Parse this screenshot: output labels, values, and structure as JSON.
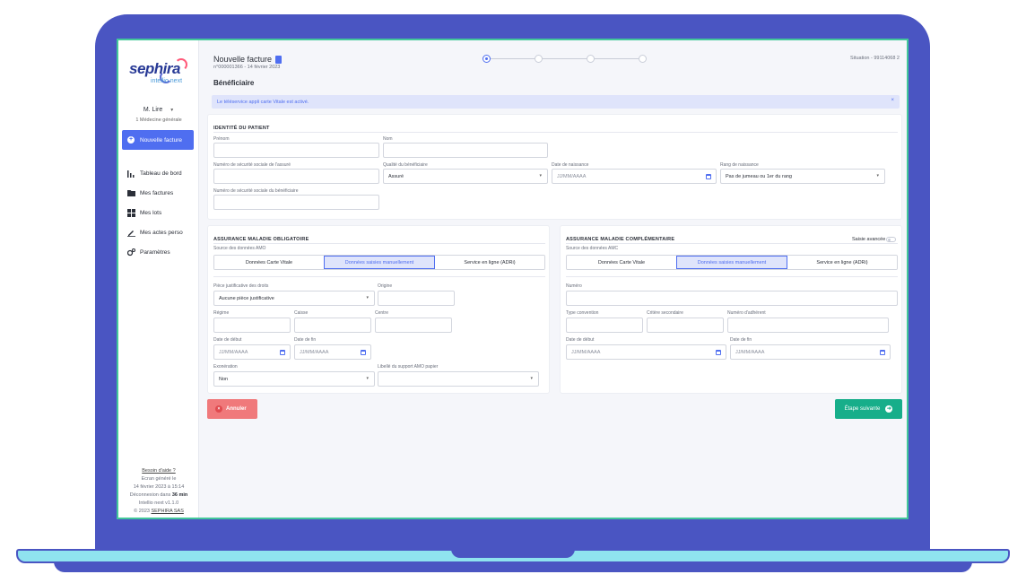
{
  "sidebar": {
    "logo_main": "sephira",
    "logo_sub": "intellio next",
    "user_name": "M. Lire",
    "user_role": "1 Médecine générale",
    "new_invoice_label": "Nouvelle facture",
    "items": [
      {
        "label": "Tableau de bord",
        "icon": "bar-chart-icon"
      },
      {
        "label": "Mes factures",
        "icon": "folder-icon"
      },
      {
        "label": "Mes lots",
        "icon": "grid-icon"
      },
      {
        "label": "Mes actes perso",
        "icon": "pencil-icon"
      },
      {
        "label": "Paramètres",
        "icon": "gears-icon"
      }
    ],
    "footer": {
      "help": "Besoin d'aide ?",
      "generated": "Ecran généré le",
      "generated_date": "14 février 2023 à 15:14",
      "logout_prefix": "Déconnexion dans",
      "logout_time": "36 min",
      "version": "Intellio next v1.1.0",
      "copyright_prefix": "© 2023",
      "copyright_link": "SEPHIRA SAS"
    }
  },
  "header": {
    "title": "Nouvelle facture",
    "subtitle": "n°000001366 - 14 février 2023",
    "situation": "Situation - 99114068 2",
    "section": "Bénéficiaire",
    "steps": 4,
    "active_step": 1
  },
  "alert": {
    "text": "Le téléservice appli carte Vitale est activé.",
    "close": "×"
  },
  "identity": {
    "heading": "IDENTITÉ DU PATIENT",
    "prenom_label": "Prénom",
    "nom_label": "Nom",
    "nss_label": "Numéro de sécurité sociale de l'assuré",
    "qualite_label": "Qualité du bénéficiaire",
    "qualite_value": "Assuré",
    "naissance_label": "Date de naissance",
    "naissance_ph": "JJ/MM/AAAA",
    "rang_label": "Rang de naissance",
    "rang_value": "Pas de jumeau ou 1er du rang",
    "nss_benef_label": "Numéro de sécurité sociale du bénéficiaire"
  },
  "amo": {
    "heading": "ASSURANCE MALADIE OBLIGATOIRE",
    "source_label": "Source des données AMO",
    "options": [
      "Données Carte Vitale",
      "Données saisies manuellement",
      "Service en ligne (ADRi)"
    ],
    "selected": 1,
    "piece_label": "Pièce justificative des droits",
    "piece_value": "Aucune pièce justificative",
    "origine_label": "Origine",
    "regime_label": "Régime",
    "caisse_label": "Caisse",
    "centre_label": "Centre",
    "debut_label": "Date de début",
    "fin_label": "Date de fin",
    "date_ph": "JJ/MM/AAAA",
    "exo_label": "Exonération",
    "exo_value": "Non",
    "libelle_label": "Libellé du support AMO papier"
  },
  "amc": {
    "heading": "ASSURANCE MALADIE COMPLÉMENTAIRE",
    "advanced_label": "Saisie avancée",
    "source_label": "Source des données AMC",
    "options": [
      "Données Carte Vitale",
      "Données saisies manuellement",
      "Service en ligne (ADRi)"
    ],
    "selected": 1,
    "numero_label": "Numéro",
    "type_label": "Type convention",
    "critere_label": "Critère secondaire",
    "adherent_label": "Numéro d'adhérent",
    "debut_label": "Date de début",
    "fin_label": "Date de fin",
    "date_ph": "JJ/MM/AAAA"
  },
  "actions": {
    "cancel": "Annuler",
    "next": "Étape suivante"
  },
  "colors": {
    "frame": "#4a55c2",
    "primary": "#4f6ef0",
    "success": "#17ae8a",
    "danger": "#f0797b"
  }
}
